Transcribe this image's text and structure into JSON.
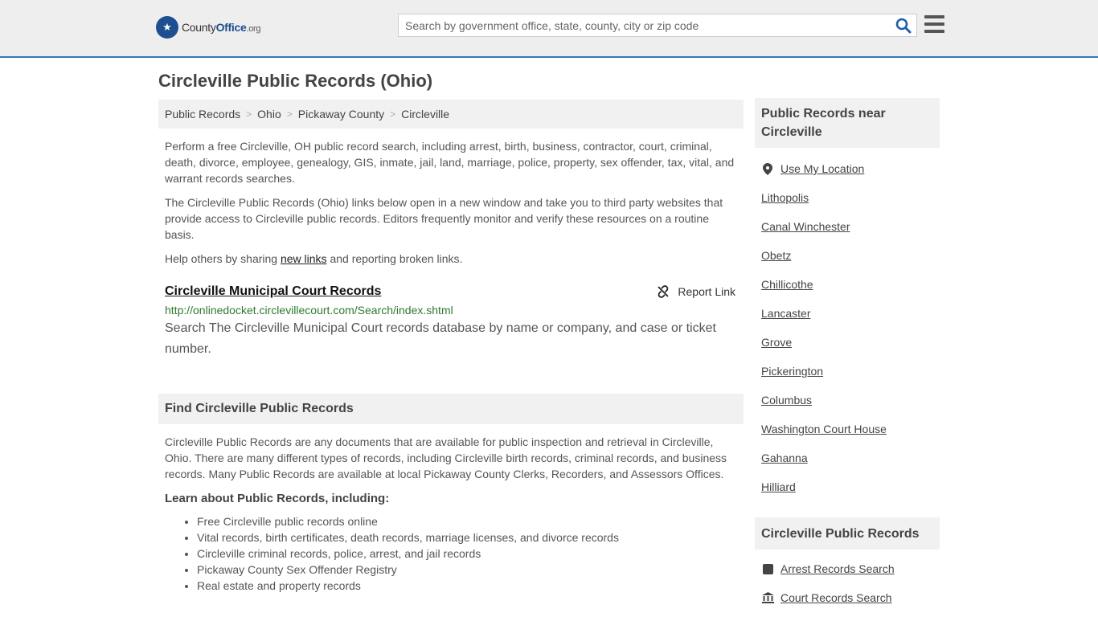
{
  "header": {
    "logo": {
      "name": "County",
      "name_strong": "Office",
      "tld": ".org"
    },
    "search_placeholder": "Search by government office, state, county, city or zip code"
  },
  "page_title": "Circleville Public Records (Ohio)",
  "breadcrumb": [
    "Public Records",
    "Ohio",
    "Pickaway County",
    "Circleville"
  ],
  "intro": {
    "p1": "Perform a free Circleville, OH public record search, including arrest, birth, business, contractor, court, criminal, death, divorce, employee, genealogy, GIS, inmate, jail, land, marriage, police, property, sex offender, tax, vital, and warrant records searches.",
    "p2": "The Circleville Public Records (Ohio) links below open in a new window and take you to third party websites that provide access to Circleville public records. Editors frequently monitor and verify these resources on a routine basis.",
    "p3_before": "Help others by sharing ",
    "p3_link": "new links",
    "p3_after": " and reporting broken links."
  },
  "record": {
    "title": "Circleville Municipal Court Records",
    "report_label": "Report Link",
    "url": "http://onlinedocket.circlevillecourt.com/Search/index.shtml",
    "description": "Search The Circleville Municipal Court records database by name or company, and case or ticket number."
  },
  "find_section": {
    "heading": "Find Circleville Public Records",
    "text": "Circleville Public Records are any documents that are available for public inspection and retrieval in Circleville, Ohio. There are many different types of records, including Circleville birth records, criminal records, and business records. Many Public Records are available at local Pickaway County Clerks, Recorders, and Assessors Offices.",
    "learn_heading": "Learn about Public Records, including:",
    "bullets": [
      "Free Circleville public records online",
      "Vital records, birth certificates, death records, marriage licenses, and divorce records",
      "Circleville criminal records, police, arrest, and jail records",
      "Pickaway County Sex Offender Registry",
      "Real estate and property records"
    ]
  },
  "sidebar": {
    "near_heading": "Public Records near Circleville",
    "use_location": "Use My Location",
    "nearby": [
      "Lithopolis",
      "Canal Winchester",
      "Obetz",
      "Chillicothe",
      "Lancaster",
      "Grove",
      "Pickerington",
      "Columbus",
      "Washington Court House",
      "Gahanna",
      "Hilliard"
    ],
    "records_heading": "Circleville Public Records",
    "records_links": [
      "Arrest Records Search",
      "Court Records Search"
    ]
  },
  "colors": {
    "header_bg": "#eeeeee",
    "accent": "#3676b6",
    "url_green": "#2f7a2f",
    "box_bg": "#f1f1f1"
  }
}
